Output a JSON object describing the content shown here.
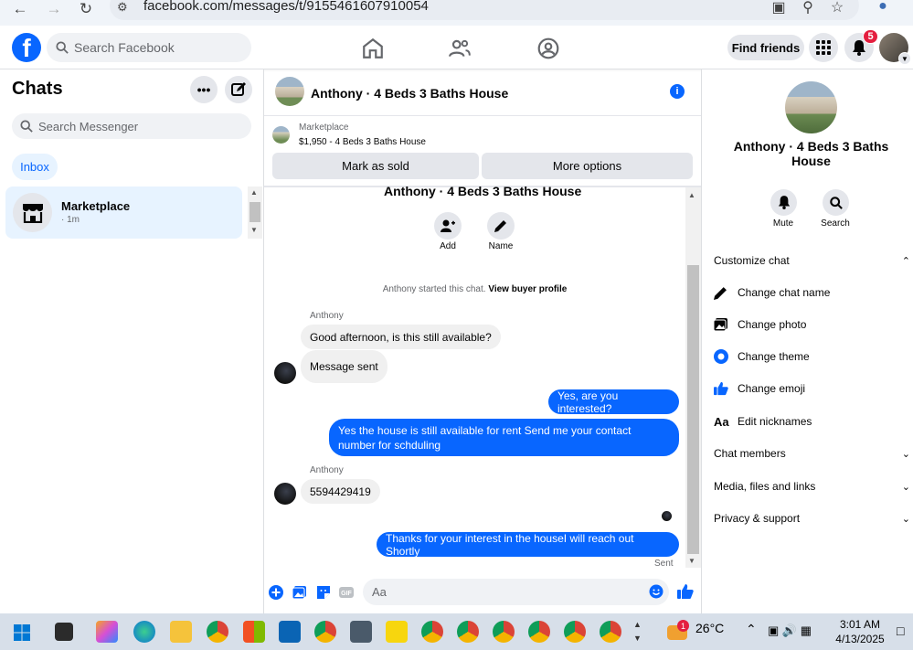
{
  "browser": {
    "url": "facebook.com/messages/t/9155461607910054"
  },
  "header": {
    "logo": "f",
    "search_placeholder": "Search Facebook",
    "find_friends": "Find friends",
    "notif_count": "5"
  },
  "chats": {
    "title": "Chats",
    "search_placeholder": "Search Messenger",
    "inbox": "Inbox",
    "items": [
      {
        "name": "Marketplace",
        "time": "· 1m"
      }
    ]
  },
  "conversation": {
    "title": "Anthony · 4 Beds 3 Baths House",
    "marketplace_label": "Marketplace",
    "listing": "$1,950 - 4 Beds 3 Baths House",
    "mark_sold": "Mark as sold",
    "more_options": "More options",
    "thread_title": "Anthony · 4 Beds 3 Baths House",
    "add_label": "Add",
    "name_label": "Name",
    "started_text": "Anthony started this chat.",
    "view_profile": "View buyer profile",
    "messages": [
      {
        "sender": "Anthony",
        "text": "Good afternoon, is this still available?"
      },
      {
        "text": "Message sent"
      },
      {
        "text": "Yes, are you interested?"
      },
      {
        "text": "Yes the house is still available for rent Send me your contact number for schduling"
      },
      {
        "sender": "Anthony",
        "text": "5594429419"
      },
      {
        "text": "Thanks for your interest in the houseI will reach out Shortly"
      }
    ],
    "sent_status": "Sent",
    "composer_placeholder": "Aa"
  },
  "details": {
    "name": "Anthony · 4 Beds 3 Baths House",
    "mute": "Mute",
    "search": "Search",
    "customize_chat": "Customize chat",
    "change_chat_name": "Change chat name",
    "change_photo": "Change photo",
    "change_theme": "Change theme",
    "change_emoji": "Change emoji",
    "edit_nicknames": "Edit nicknames",
    "chat_members": "Chat members",
    "media": "Media, files and links",
    "privacy": "Privacy & support",
    "aa_icon": "Aa"
  },
  "taskbar": {
    "weather": "26°C",
    "time": "3:01 AM",
    "date": "4/13/2025",
    "weather_badge": "1"
  },
  "colors": {
    "brand": "#0866ff",
    "bubble_out": "#0866ff",
    "bubble_in": "#f0f0f0"
  }
}
